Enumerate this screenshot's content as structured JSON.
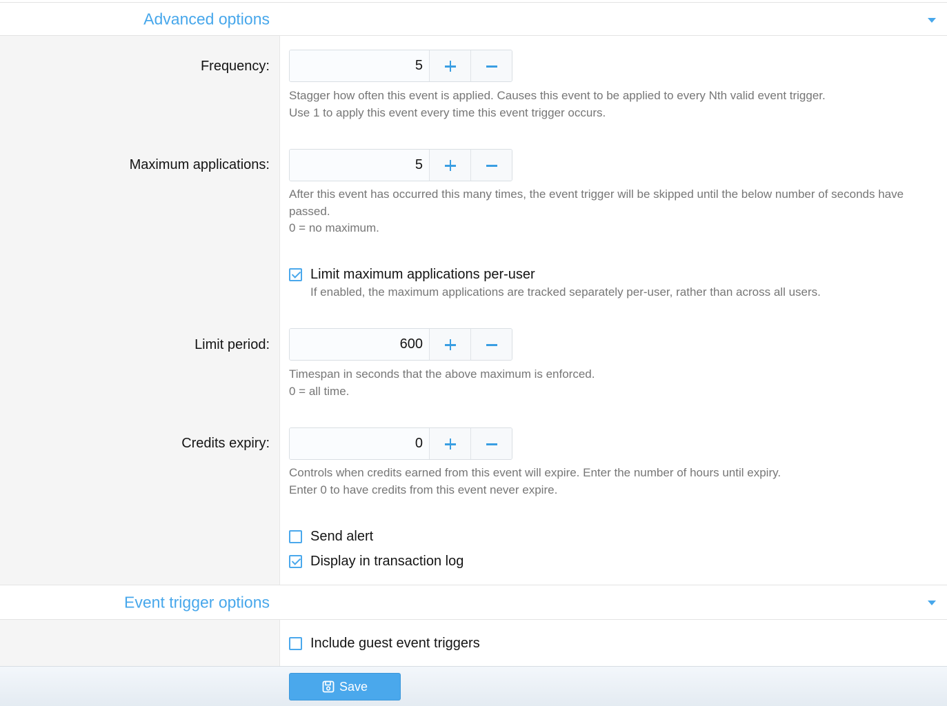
{
  "advanced": {
    "title": "Advanced options",
    "frequency": {
      "label": "Frequency:",
      "value": "5",
      "help": [
        "Stagger how often this event is applied. Causes this event to be applied to every Nth valid event trigger.",
        "Use 1 to apply this event every time this event trigger occurs."
      ]
    },
    "max_applications": {
      "label": "Maximum applications:",
      "value": "5",
      "help": [
        "After this event has occurred this many times, the event trigger will be skipped until the below number of seconds have passed.",
        "0 = no maximum."
      ]
    },
    "limit_per_user": {
      "label": "Limit maximum applications per-user",
      "checked": true,
      "help": "If enabled, the maximum applications are tracked separately per-user, rather than across all users."
    },
    "limit_period": {
      "label": "Limit period:",
      "value": "600",
      "help": [
        "Timespan in seconds that the above maximum is enforced.",
        "0 = all time."
      ]
    },
    "credits_expiry": {
      "label": "Credits expiry:",
      "value": "0",
      "help": [
        "Controls when credits earned from this event will expire. Enter the number of hours until expiry.",
        "Enter 0 to have credits from this event never expire."
      ]
    },
    "send_alert": {
      "label": "Send alert",
      "checked": false
    },
    "display_log": {
      "label": "Display in transaction log",
      "checked": true
    }
  },
  "event_trigger": {
    "title": "Event trigger options",
    "include_guest": {
      "label": "Include guest event triggers",
      "checked": false
    }
  },
  "footer": {
    "save_label": "Save"
  },
  "colors": {
    "accent": "#47a7eb",
    "label_bg": "#f5f5f5",
    "help_text": "#767676"
  },
  "icons": {
    "collapse": "caret-down-icon",
    "increment": "plus-icon",
    "decrement": "minus-icon",
    "save": "floppy-disk-icon"
  }
}
